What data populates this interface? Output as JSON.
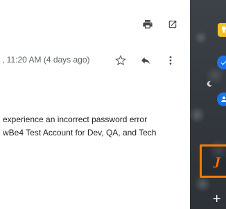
{
  "toolbar": {
    "print_icon": "print-icon",
    "popout_icon": "open-in-new-window-icon"
  },
  "message": {
    "timestamp": ", 11:20 AM (4 days ago)",
    "star_icon": "star-outline-icon",
    "reply_icon": "reply-icon",
    "more_icon": "more-vertical-icon",
    "body_lines": [
      " experience an incorrect password error",
      "wBe4 Test Account for Dev, QA, and Tech"
    ]
  },
  "side_panel": {
    "apps": [
      {
        "name": "keep-icon",
        "color": "#f6bf26"
      },
      {
        "name": "tasks-icon",
        "color": "#1a73e8"
      },
      {
        "name": "contacts-icon",
        "color": "#1a73e8"
      },
      {
        "name": "addon-icon",
        "color": "#ff6d00"
      }
    ],
    "addon_label": "J",
    "add_label": "+",
    "highlight_color": "#f57c00"
  }
}
